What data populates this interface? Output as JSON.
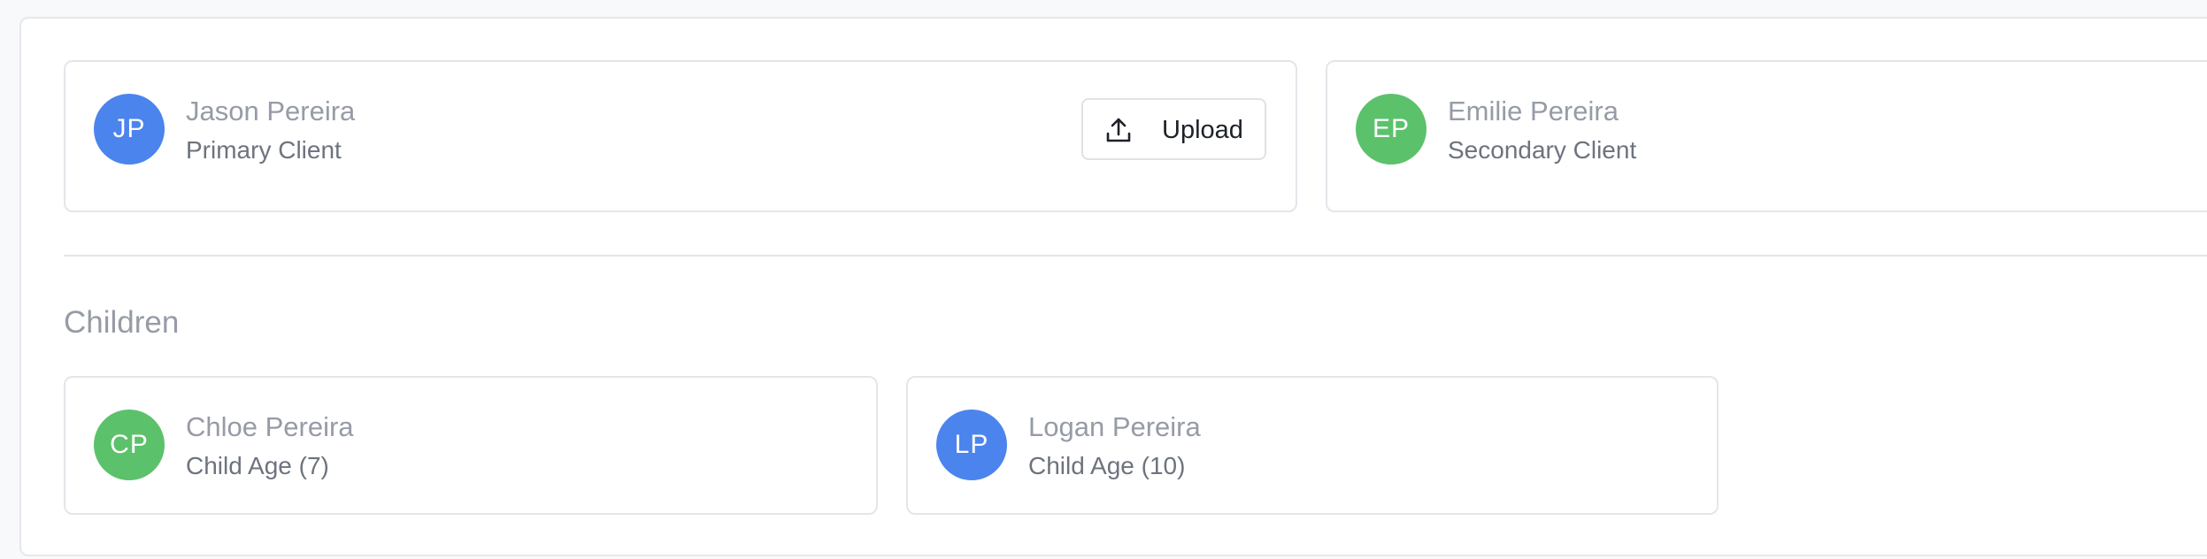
{
  "clients": [
    {
      "initials": "JP",
      "name": "Jason Pereira",
      "role": "Primary Client",
      "avatar_color": "#4c84ee",
      "action_label": "Upload",
      "action_icon": "upload-icon"
    },
    {
      "initials": "EP",
      "name": "Emilie Pereira",
      "role": "Secondary Client",
      "avatar_color": "#5cc16b"
    }
  ],
  "children_section": {
    "title": "Children",
    "items": [
      {
        "initials": "CP",
        "name": "Chloe Pereira",
        "role": "Child Age (7)",
        "avatar_color": "#5cc16b"
      },
      {
        "initials": "LP",
        "name": "Logan Pereira",
        "role": "Child Age (10)",
        "avatar_color": "#4c84ee"
      }
    ]
  }
}
